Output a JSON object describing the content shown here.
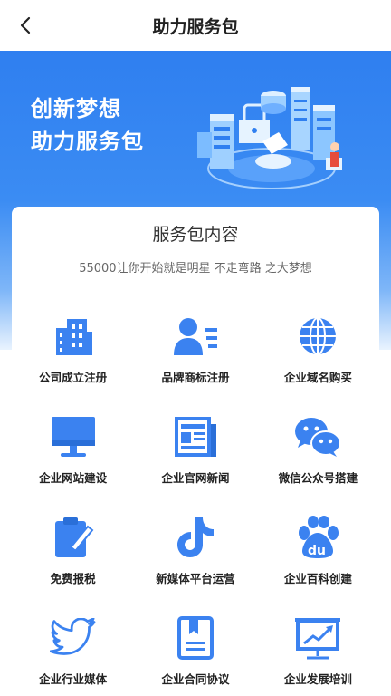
{
  "header": {
    "title": "助力服务包"
  },
  "hero": {
    "line1": "创新梦想",
    "line2": "助力服务包"
  },
  "card": {
    "title": "服务包内容",
    "subtitle": "55000让你开始就是明星 不走弯路 之大梦想"
  },
  "services": [
    {
      "label": "公司成立注册",
      "icon": "building-icon"
    },
    {
      "label": "品牌商标注册",
      "icon": "user-card-icon"
    },
    {
      "label": "企业域名购买",
      "icon": "globe-icon"
    },
    {
      "label": "企业网站建设",
      "icon": "monitor-icon"
    },
    {
      "label": "企业官网新闻",
      "icon": "newspaper-icon"
    },
    {
      "label": "微信公众号搭建",
      "icon": "wechat-icon"
    },
    {
      "label": "免费报税",
      "icon": "clipboard-pen-icon"
    },
    {
      "label": "新媒体平台运营",
      "icon": "tiktok-icon"
    },
    {
      "label": "企业百科创建",
      "icon": "baidu-paw-icon"
    },
    {
      "label": "企业行业媒体",
      "icon": "twitter-bird-icon"
    },
    {
      "label": "企业合同协议",
      "icon": "contract-book-icon"
    },
    {
      "label": "企业发展培训",
      "icon": "presentation-board-icon"
    }
  ],
  "colors": {
    "accent": "#3b82f0",
    "hero_top": "#2f7ff0"
  }
}
